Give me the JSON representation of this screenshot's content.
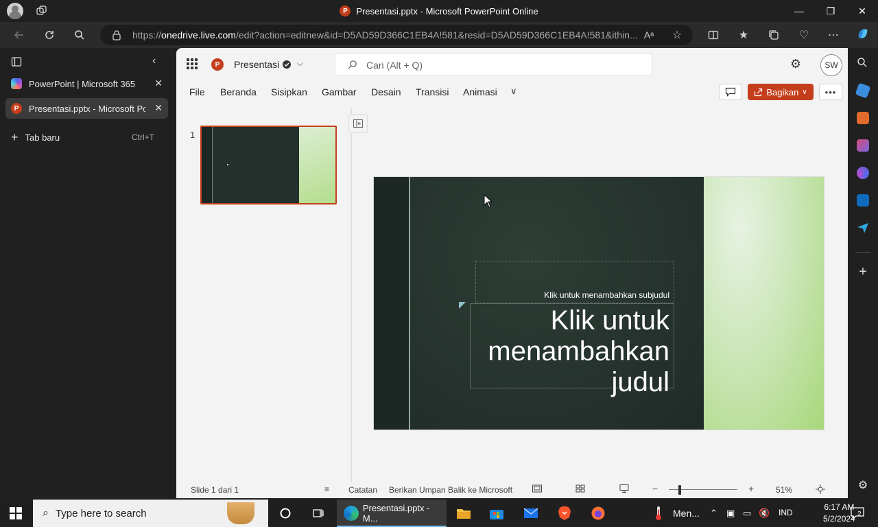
{
  "browser": {
    "window_title": "Presentasi.pptx - Microsoft PowerPoint Online",
    "url_prefix": "https://",
    "url_domain": "onedrive.live.com",
    "url_rest": "/edit?action=editnew&id=D5AD59D366C1EB4A!581&resid=D5AD59D366C1EB4A!581&ithin...",
    "tabs": [
      {
        "label": "PowerPoint | Microsoft 365",
        "icon": "m365-icon"
      },
      {
        "label": "Presentasi.pptx - Microsoft PowerPoint Online",
        "icon": "powerpoint-icon"
      }
    ],
    "new_tab_label": "Tab baru",
    "new_tab_shortcut": "Ctrl+T"
  },
  "app": {
    "logo_letter": "P",
    "doc_name": "Presentasi",
    "search_placeholder": "Cari (Alt + Q)",
    "user_initials": "SW",
    "ribbon_tabs": [
      "File",
      "Beranda",
      "Sisipkan",
      "Gambar",
      "Desain",
      "Transisi",
      "Animasi"
    ],
    "share_label": "Bagikan",
    "accent_color": "#c43e1c"
  },
  "thumbnails": [
    {
      "number": "1"
    }
  ],
  "slide": {
    "subtitle_placeholder": "Klik untuk menambahkan subjudul",
    "title_placeholder": "Klik untuk menambahkan judul"
  },
  "status_bar": {
    "slide_counter": "Slide 1 dari 1",
    "notes_label": "Catatan",
    "feedback_label": "Berikan Umpan Balik ke Microsoft",
    "zoom": "51%"
  },
  "taskbar": {
    "search_placeholder": "Type here to search",
    "active_app_label": "Presentasi.pptx - M...",
    "weather_label": "Men...",
    "language": "IND",
    "time": "6:17 AM",
    "date": "5/2/2024",
    "notification_count": "2"
  }
}
